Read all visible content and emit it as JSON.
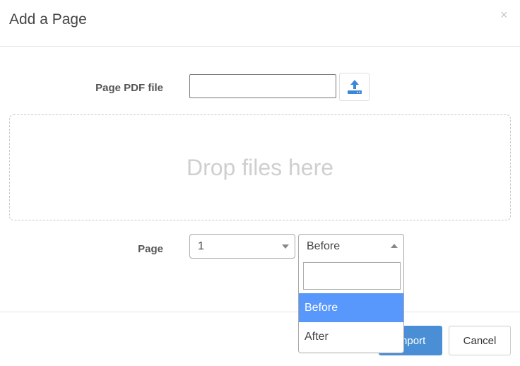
{
  "dialog": {
    "title": "Add a Page",
    "close_label": "×"
  },
  "form": {
    "pdf_label": "Page PDF file",
    "file_value": "",
    "dropzone_text": "Drop files here",
    "page_label": "Page",
    "page_select_value": "1",
    "position_select_value": "Before"
  },
  "dropdown": {
    "search_value": "",
    "options": [
      "Before",
      "After"
    ],
    "highlighted": "Before"
  },
  "footer": {
    "import_label": "Import",
    "cancel_label": "Cancel"
  },
  "colors": {
    "primary": "#4a8fd6",
    "highlight": "#5897fb"
  },
  "icons": {
    "upload": "upload-icon"
  }
}
